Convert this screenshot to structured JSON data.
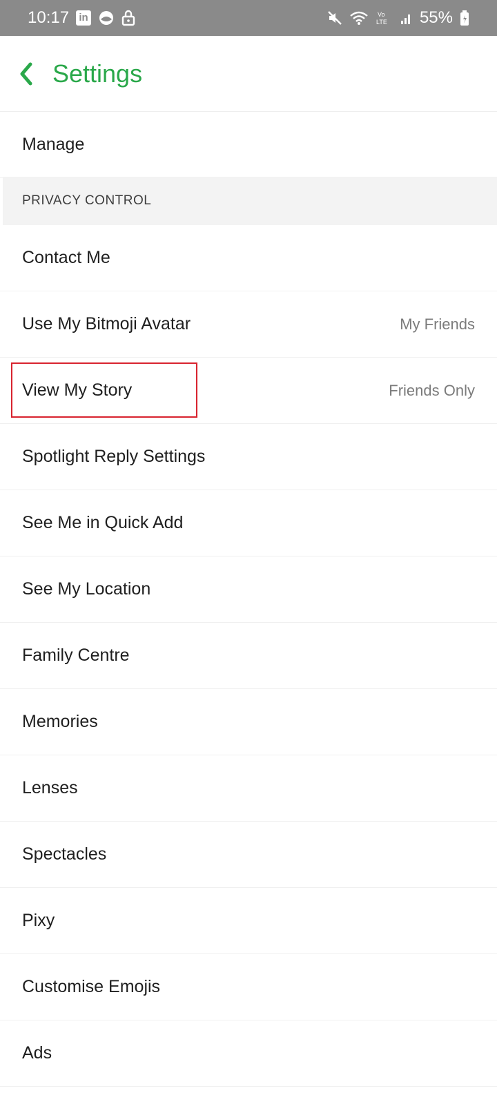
{
  "status_bar": {
    "time": "10:17",
    "linkedin_glyph": "in",
    "battery": "55%",
    "icons": [
      "linkedin-icon",
      "app-icon",
      "lock-icon",
      "mute-icon",
      "wifi-icon",
      "volte-icon",
      "signal-icon",
      "battery-icon"
    ]
  },
  "header": {
    "title": "Settings",
    "back_icon": "chevron-left-icon",
    "accent_color": "#2aa84a"
  },
  "manage_row": {
    "label": "Manage"
  },
  "section": {
    "label": "PRIVACY CONTROL"
  },
  "privacy_items": [
    {
      "label": "Contact Me",
      "value": ""
    },
    {
      "label": "Use My Bitmoji Avatar",
      "value": "My Friends"
    },
    {
      "label": "View My Story",
      "value": "Friends Only"
    },
    {
      "label": "Spotlight Reply Settings",
      "value": ""
    },
    {
      "label": "See Me in Quick Add",
      "value": ""
    },
    {
      "label": "See My Location",
      "value": ""
    },
    {
      "label": "Family Centre",
      "value": ""
    },
    {
      "label": "Memories",
      "value": ""
    },
    {
      "label": "Lenses",
      "value": ""
    },
    {
      "label": "Spectacles",
      "value": ""
    },
    {
      "label": "Pixy",
      "value": ""
    },
    {
      "label": "Customise Emojis",
      "value": ""
    },
    {
      "label": "Ads",
      "value": ""
    }
  ],
  "highlight": {
    "color": "#d8232f",
    "target": "View My Story"
  }
}
